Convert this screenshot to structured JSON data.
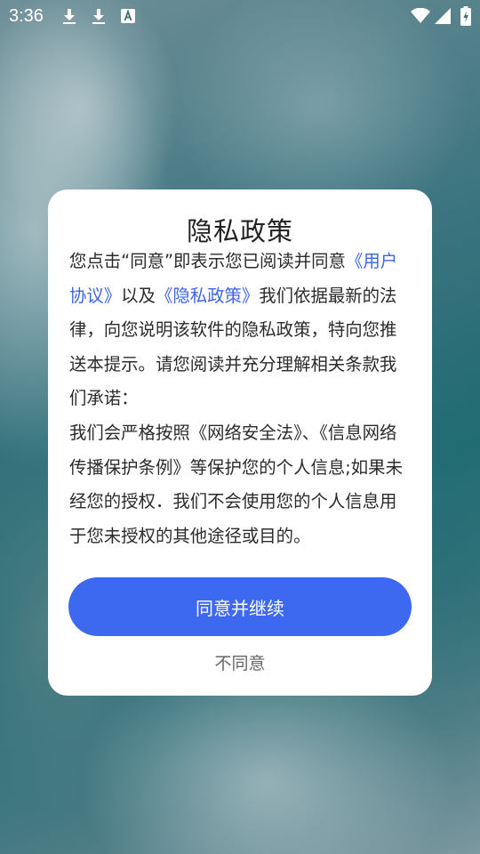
{
  "status_bar": {
    "time": "3:36",
    "icons": [
      "download-icon",
      "download-icon",
      "keyboard-a-icon",
      "wifi-icon",
      "signal-icon",
      "battery-icon"
    ]
  },
  "dialog": {
    "title": "隐私政策",
    "body_intro": "您点击“同意”即表示您已阅读并同意",
    "link_user_agreement": "《用户协议》",
    "body_and": "以及",
    "link_privacy_policy": "《隐私政策》",
    "body_main": "我们依据最新的法律，向您说明该软件的隐私政策，特向您推送本提示。请您阅读并充分理解相关条款我们承诺：",
    "body_promise": "我们会严格按照《网络安全法》、《信息网络传播保护条例》等保护您的个人信息;如果未经您的授权．我们不会使用您的个人信息用于您未授权的其他途径或目的。",
    "agree_button": "同意并继续",
    "disagree_button": "不同意"
  },
  "colors": {
    "accent": "#3d68f0",
    "link": "#3d66e6",
    "dialog_bg": "#ffffff"
  }
}
